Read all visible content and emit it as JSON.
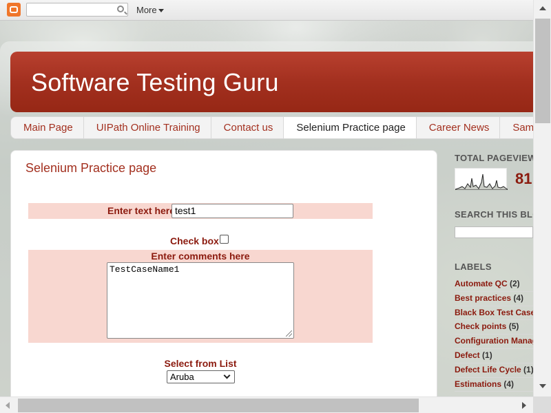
{
  "navbar": {
    "logo_icon": "blogger-icon",
    "search_placeholder": "",
    "more_label": "More"
  },
  "blog": {
    "title": "Software Testing Guru"
  },
  "tabs": [
    {
      "label": "Main Page",
      "active": false
    },
    {
      "label": "UIPath Online Training",
      "active": false
    },
    {
      "label": "Contact us",
      "active": false
    },
    {
      "label": "Selenium Practice page",
      "active": true
    },
    {
      "label": "Career News",
      "active": false
    },
    {
      "label": "Sample",
      "active": false
    }
  ],
  "post": {
    "title": "Selenium Practice page",
    "text_label": "Enter text here",
    "text_value": "test1",
    "checkbox_label": "Check box",
    "checkbox_checked": false,
    "comments_label": "Enter comments here",
    "comments_value": "TestCaseName1",
    "select_label": "Select from List",
    "select_value": "Aruba"
  },
  "sidebar": {
    "pageviews_heading": "TOTAL PAGEVIEWS",
    "pageviews_count": "81",
    "search_heading": "SEARCH THIS BLOG",
    "labels_heading": "LABELS",
    "labels": [
      {
        "name": "Automate QC",
        "count": "(2)"
      },
      {
        "name": "Best practices",
        "count": "(4)"
      },
      {
        "name": "Black Box Test Case",
        "count": ""
      },
      {
        "name": "Check points",
        "count": "(5)"
      },
      {
        "name": "Configuration Manag",
        "count": ""
      },
      {
        "name": "Defect",
        "count": "(1)"
      },
      {
        "name": "Defect Life Cycle",
        "count": "(1)"
      },
      {
        "name": "Estimations",
        "count": "(4)"
      }
    ]
  },
  "colors": {
    "header_red": "#a3301f",
    "link_red": "#8b1a0e",
    "highlight_row": "#f8d7d0"
  }
}
